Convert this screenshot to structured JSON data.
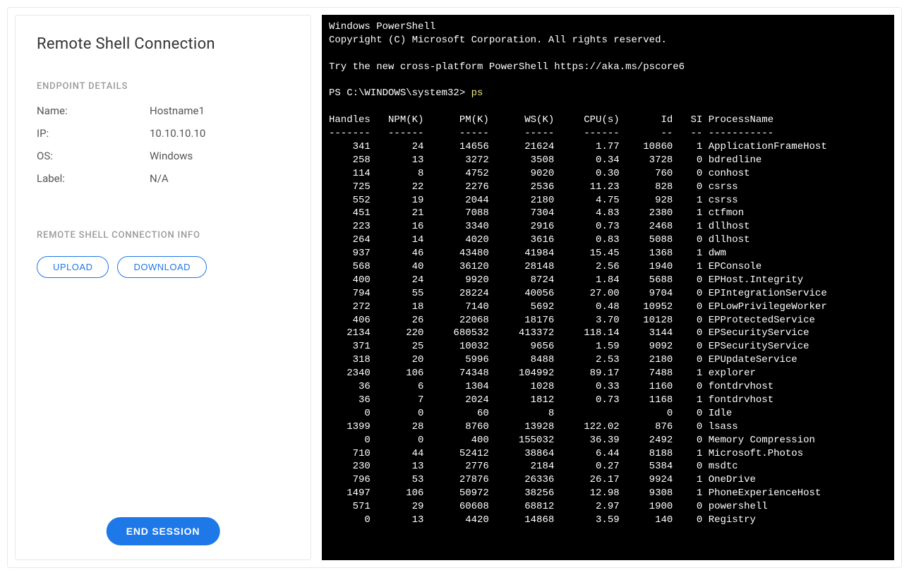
{
  "panel": {
    "title": "Remote Shell Connection",
    "endpoint_section_label": "ENDPOINT DETAILS",
    "details": {
      "name_key": "Name:",
      "name_val": "Hostname1",
      "ip_key": "IP:",
      "ip_val": "10.10.10.10",
      "os_key": "OS:",
      "os_val": "Windows",
      "label_key": "Label:",
      "label_val": "N/A"
    },
    "conn_section_label": "REMOTE SHELL CONNECTION INFO",
    "upload_label": "UPLOAD",
    "download_label": "DOWNLOAD",
    "end_session_label": "END SESSION"
  },
  "terminal": {
    "banner1": "Windows PowerShell",
    "banner2": "Copyright (C) Microsoft Corporation. All rights reserved.",
    "banner3": "Try the new cross-platform PowerShell https://aka.ms/pscore6",
    "prompt": "PS C:\\WINDOWS\\system32> ",
    "command": "ps",
    "columns": [
      "Handles",
      "NPM(K)",
      "PM(K)",
      "WS(K)",
      "CPU(s)",
      "Id",
      "SI",
      "ProcessName"
    ],
    "rows": [
      {
        "Handles": "341",
        "NPM": "24",
        "PM": "14656",
        "WS": "21624",
        "CPU": "1.77",
        "Id": "10860",
        "SI": "1",
        "Name": "ApplicationFrameHost"
      },
      {
        "Handles": "258",
        "NPM": "13",
        "PM": "3272",
        "WS": "3508",
        "CPU": "0.34",
        "Id": "3728",
        "SI": "0",
        "Name": "bdredline"
      },
      {
        "Handles": "114",
        "NPM": "8",
        "PM": "4752",
        "WS": "9020",
        "CPU": "0.30",
        "Id": "760",
        "SI": "0",
        "Name": "conhost"
      },
      {
        "Handles": "725",
        "NPM": "22",
        "PM": "2276",
        "WS": "2536",
        "CPU": "11.23",
        "Id": "828",
        "SI": "0",
        "Name": "csrss"
      },
      {
        "Handles": "552",
        "NPM": "19",
        "PM": "2044",
        "WS": "2180",
        "CPU": "4.75",
        "Id": "928",
        "SI": "1",
        "Name": "csrss"
      },
      {
        "Handles": "451",
        "NPM": "21",
        "PM": "7088",
        "WS": "7304",
        "CPU": "4.83",
        "Id": "2380",
        "SI": "1",
        "Name": "ctfmon"
      },
      {
        "Handles": "223",
        "NPM": "16",
        "PM": "3340",
        "WS": "2916",
        "CPU": "0.73",
        "Id": "2468",
        "SI": "1",
        "Name": "dllhost"
      },
      {
        "Handles": "264",
        "NPM": "14",
        "PM": "4020",
        "WS": "3616",
        "CPU": "0.83",
        "Id": "5088",
        "SI": "0",
        "Name": "dllhost"
      },
      {
        "Handles": "937",
        "NPM": "46",
        "PM": "43480",
        "WS": "41984",
        "CPU": "15.45",
        "Id": "1368",
        "SI": "1",
        "Name": "dwm"
      },
      {
        "Handles": "568",
        "NPM": "40",
        "PM": "36120",
        "WS": "28148",
        "CPU": "2.56",
        "Id": "1940",
        "SI": "1",
        "Name": "EPConsole"
      },
      {
        "Handles": "400",
        "NPM": "24",
        "PM": "9920",
        "WS": "8724",
        "CPU": "1.84",
        "Id": "5688",
        "SI": "0",
        "Name": "EPHost.Integrity"
      },
      {
        "Handles": "794",
        "NPM": "55",
        "PM": "28224",
        "WS": "40056",
        "CPU": "27.00",
        "Id": "9704",
        "SI": "0",
        "Name": "EPIntegrationService"
      },
      {
        "Handles": "272",
        "NPM": "18",
        "PM": "7140",
        "WS": "5692",
        "CPU": "0.48",
        "Id": "10952",
        "SI": "0",
        "Name": "EPLowPrivilegeWorker"
      },
      {
        "Handles": "406",
        "NPM": "26",
        "PM": "22068",
        "WS": "18176",
        "CPU": "3.70",
        "Id": "10128",
        "SI": "0",
        "Name": "EPProtectedService"
      },
      {
        "Handles": "2134",
        "NPM": "220",
        "PM": "680532",
        "WS": "413372",
        "CPU": "118.14",
        "Id": "3144",
        "SI": "0",
        "Name": "EPSecurityService"
      },
      {
        "Handles": "371",
        "NPM": "25",
        "PM": "10032",
        "WS": "9656",
        "CPU": "1.59",
        "Id": "9092",
        "SI": "0",
        "Name": "EPSecurityService"
      },
      {
        "Handles": "318",
        "NPM": "20",
        "PM": "5996",
        "WS": "8488",
        "CPU": "2.53",
        "Id": "2180",
        "SI": "0",
        "Name": "EPUpdateService"
      },
      {
        "Handles": "2340",
        "NPM": "106",
        "PM": "74348",
        "WS": "104992",
        "CPU": "89.17",
        "Id": "7488",
        "SI": "1",
        "Name": "explorer"
      },
      {
        "Handles": "36",
        "NPM": "6",
        "PM": "1304",
        "WS": "1028",
        "CPU": "0.33",
        "Id": "1160",
        "SI": "0",
        "Name": "fontdrvhost"
      },
      {
        "Handles": "36",
        "NPM": "7",
        "PM": "2024",
        "WS": "1812",
        "CPU": "0.73",
        "Id": "1168",
        "SI": "1",
        "Name": "fontdrvhost"
      },
      {
        "Handles": "0",
        "NPM": "0",
        "PM": "60",
        "WS": "8",
        "CPU": "",
        "Id": "0",
        "SI": "0",
        "Name": "Idle"
      },
      {
        "Handles": "1399",
        "NPM": "28",
        "PM": "8760",
        "WS": "13928",
        "CPU": "122.02",
        "Id": "876",
        "SI": "0",
        "Name": "lsass"
      },
      {
        "Handles": "0",
        "NPM": "0",
        "PM": "400",
        "WS": "155032",
        "CPU": "36.39",
        "Id": "2492",
        "SI": "0",
        "Name": "Memory Compression"
      },
      {
        "Handles": "710",
        "NPM": "44",
        "PM": "52412",
        "WS": "38864",
        "CPU": "6.44",
        "Id": "8188",
        "SI": "1",
        "Name": "Microsoft.Photos"
      },
      {
        "Handles": "230",
        "NPM": "13",
        "PM": "2776",
        "WS": "2184",
        "CPU": "0.27",
        "Id": "5384",
        "SI": "0",
        "Name": "msdtc"
      },
      {
        "Handles": "796",
        "NPM": "53",
        "PM": "27876",
        "WS": "26336",
        "CPU": "26.17",
        "Id": "9924",
        "SI": "1",
        "Name": "OneDrive"
      },
      {
        "Handles": "1497",
        "NPM": "106",
        "PM": "50972",
        "WS": "38256",
        "CPU": "12.98",
        "Id": "9308",
        "SI": "1",
        "Name": "PhoneExperienceHost"
      },
      {
        "Handles": "571",
        "NPM": "29",
        "PM": "60608",
        "WS": "68812",
        "CPU": "2.97",
        "Id": "1900",
        "SI": "0",
        "Name": "powershell"
      },
      {
        "Handles": "0",
        "NPM": "13",
        "PM": "4420",
        "WS": "14868",
        "CPU": "3.59",
        "Id": "140",
        "SI": "0",
        "Name": "Registry"
      }
    ]
  }
}
